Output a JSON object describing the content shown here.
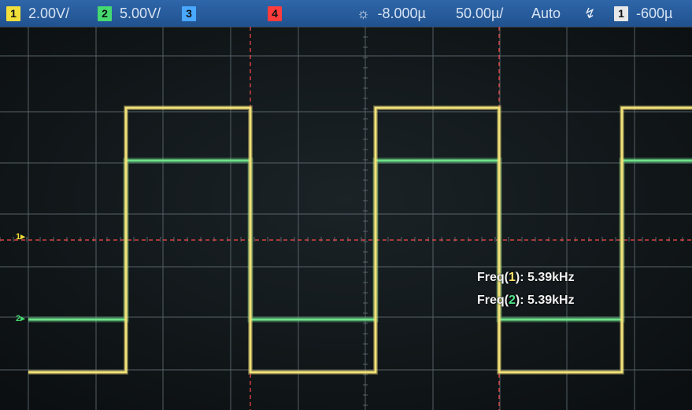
{
  "status_bar": {
    "ch1": {
      "label": "1",
      "scale": "2.00V/",
      "color": "#f2df3a"
    },
    "ch2": {
      "label": "2",
      "scale": "5.00V/",
      "color": "#45d96f"
    },
    "ch3": {
      "label": "3",
      "color": "#4aa8ff"
    },
    "ch4": {
      "label": "4",
      "color": "#ff3c3c"
    },
    "time_position": "-8.000µ",
    "time_scale": "50.00µ/",
    "trigger_mode": "Auto",
    "trigger_source": "1",
    "trigger_level": "-600µ"
  },
  "markers": {
    "ch1": "1",
    "ch2": "2"
  },
  "measurements": [
    {
      "prefix": "Freq(",
      "channel": "1",
      "suffix": "): 5.39kHz"
    },
    {
      "prefix": "Freq(",
      "channel": "2",
      "suffix": "): 5.39kHz"
    }
  ],
  "colors": {
    "ch1_trace": "#f3e27a",
    "ch2_trace": "#6ee08a",
    "grid": "#58636a",
    "cursor": "#ff4a4a"
  }
}
